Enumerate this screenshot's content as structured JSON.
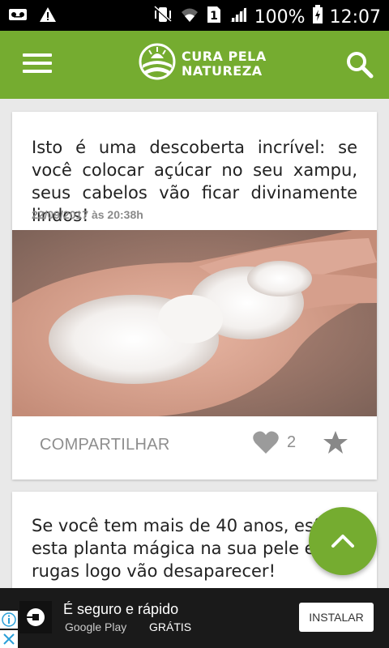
{
  "status_bar": {
    "battery_percent": "100%",
    "time": "12:07",
    "sim_number": "1"
  },
  "app_bar": {
    "logo_line1": "CURA PELA",
    "logo_line2": "NATUREZA",
    "accent_color": "#75ac30"
  },
  "feed": {
    "articles": [
      {
        "title": "Isto é uma descoberta incrível: se você colocar açúcar no seu xampu, seus cabelos vão ficar divinamente lindos!",
        "date": "22/09/2017 às 20:38h",
        "share_label": "COMPARTILHAR",
        "like_count": "2"
      },
      {
        "title": "Se você tem mais de 40 anos, esfr esta planta mágica na sua pele e rugas logo vão desaparecer!"
      }
    ]
  },
  "ad": {
    "headline": "É seguro e rápido",
    "sub": "Google Play",
    "free_label": "GRÁTIS",
    "install_label": "INSTALAR"
  }
}
